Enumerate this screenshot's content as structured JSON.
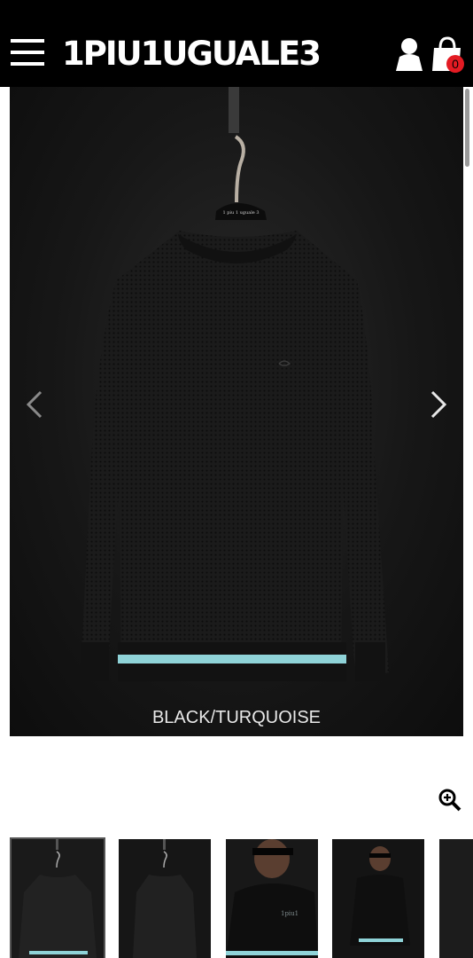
{
  "header": {
    "brand": "1PIU1UGUALE3",
    "cart_count": "0"
  },
  "gallery": {
    "color_caption": "BLACK/TURQUOISE",
    "stripe_color": "#8fd3d8",
    "thumbnails": [
      {
        "label": "product-front-hanger",
        "active": true
      },
      {
        "label": "product-side-hanger",
        "active": false
      },
      {
        "label": "model-closeup",
        "active": false
      },
      {
        "label": "model-full",
        "active": false
      },
      {
        "label": "partial-next",
        "active": false
      }
    ]
  }
}
